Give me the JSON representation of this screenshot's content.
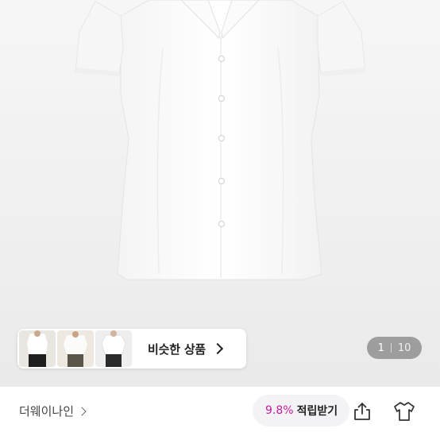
{
  "carousel": {
    "current_page": "1",
    "total_pages": "10"
  },
  "similar": {
    "label": "비슷한 상품"
  },
  "shop": {
    "name": "더웨이나인"
  },
  "points": {
    "percent": "9.8%",
    "label": "적립받기"
  },
  "icons": {
    "share": "share-icon",
    "closet": "shirt-outline-icon",
    "chevron": "chevron-right-icon"
  }
}
